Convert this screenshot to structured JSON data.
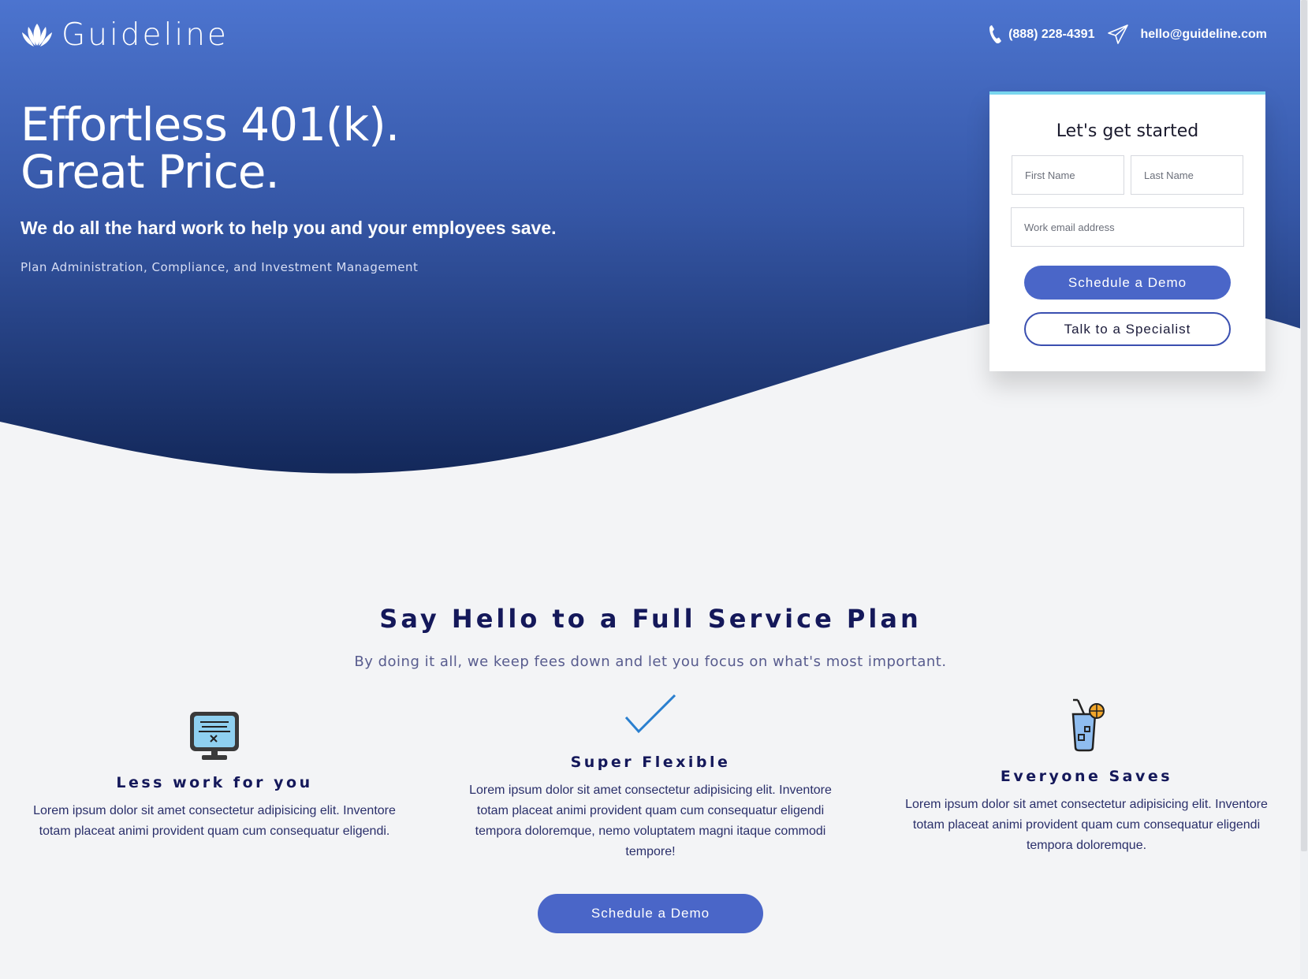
{
  "brand": {
    "name": "Guideline"
  },
  "header": {
    "phone": "(888) 228-4391",
    "email": "hello@guideline.com"
  },
  "hero": {
    "title_line1": "Effortless 401(k).",
    "title_line2": "Great Price.",
    "subtitle": "We do all the hard work to help you and your employees save.",
    "caption": "Plan Administration, Compliance, and Investment Management"
  },
  "form": {
    "title": "Let's get started",
    "first_name_placeholder": "First Name",
    "last_name_placeholder": "Last Name",
    "email_placeholder": "Work email address",
    "primary_button": "Schedule a Demo",
    "secondary_button": "Talk to a Specialist"
  },
  "features_section": {
    "title": "Say Hello to a Full Service Plan",
    "subtitle": "By doing it all, we keep fees down and let you focus on what's most important.",
    "items": [
      {
        "icon": "computer-monitor-icon",
        "title": "Less work for you",
        "text": "Lorem ipsum dolor sit amet consectetur adipisicing elit. Inventore totam placeat animi provident quam cum consequatur eligendi."
      },
      {
        "icon": "checkmark-icon",
        "title": "Super Flexible",
        "text": "Lorem ipsum dolor sit amet consectetur adipisicing elit. Inventore totam placeat animi provident quam cum consequatur eligendi tempora doloremque, nemo voluptatem magni itaque commodi tempore!"
      },
      {
        "icon": "drink-glass-icon",
        "title": "Everyone Saves",
        "text": "Lorem ipsum dolor sit amet consectetur adipisicing elit. Inventore totam placeat animi provident quam cum consequatur eligendi tempora doloremque."
      }
    ],
    "cta_button": "Schedule a Demo"
  },
  "colors": {
    "hero_top": "#4c74cf",
    "hero_bottom": "#13285a",
    "accent": "#4a66c8",
    "card_top_border": "#79d6ee",
    "heading_navy": "#14185a",
    "background": "#f3f4f6"
  }
}
